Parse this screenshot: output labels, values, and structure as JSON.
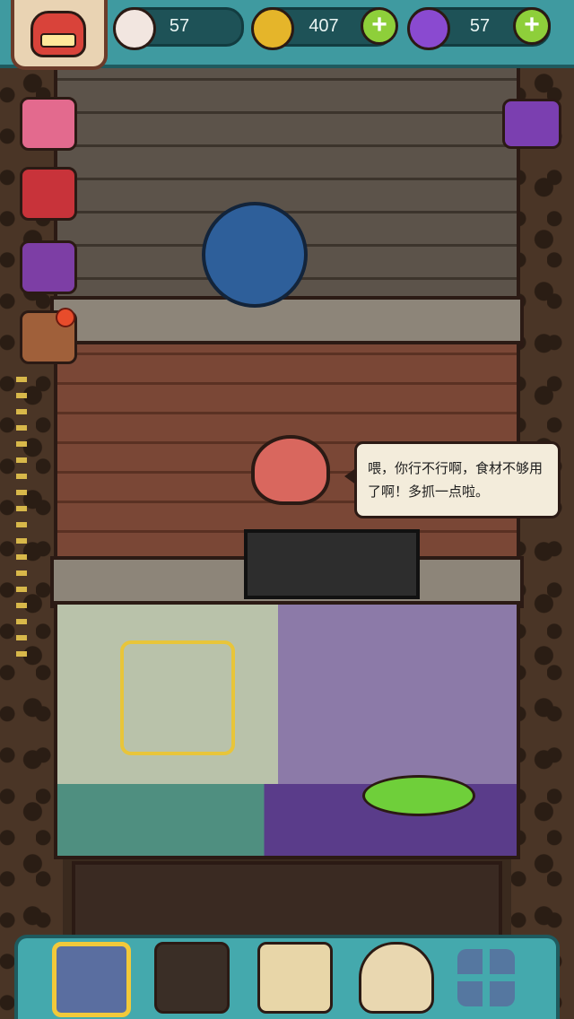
{
  "resources": {
    "eyeballs": "57",
    "coins": "407",
    "potions": "57",
    "add_symbol": "+"
  },
  "dialog": {
    "text": "喂，你行不行啊，食材不够用了啊！多抓一点啦。"
  },
  "icons": {
    "avatar": "monster-avatar-icon",
    "eyeball": "eyeball-icon",
    "coin": "coin-icon",
    "potion": "potion-icon",
    "side_buttons": [
      "gift-box-icon",
      "gift-bag-icon",
      "cards-icon",
      "chest-icon"
    ],
    "video": "video-reward-icon",
    "nav": [
      "home-building-icon",
      "monster-den-icon",
      "book-icon",
      "money-bag-icon",
      "grid-menu-icon"
    ]
  },
  "colors": {
    "bar": "#3f9aa0",
    "plus": "#8ecf3a",
    "coin": "#e5b52a",
    "potion": "#8a4ad0",
    "eyeball": "#f2e6e0",
    "selected_nav": "#f2c93a"
  }
}
